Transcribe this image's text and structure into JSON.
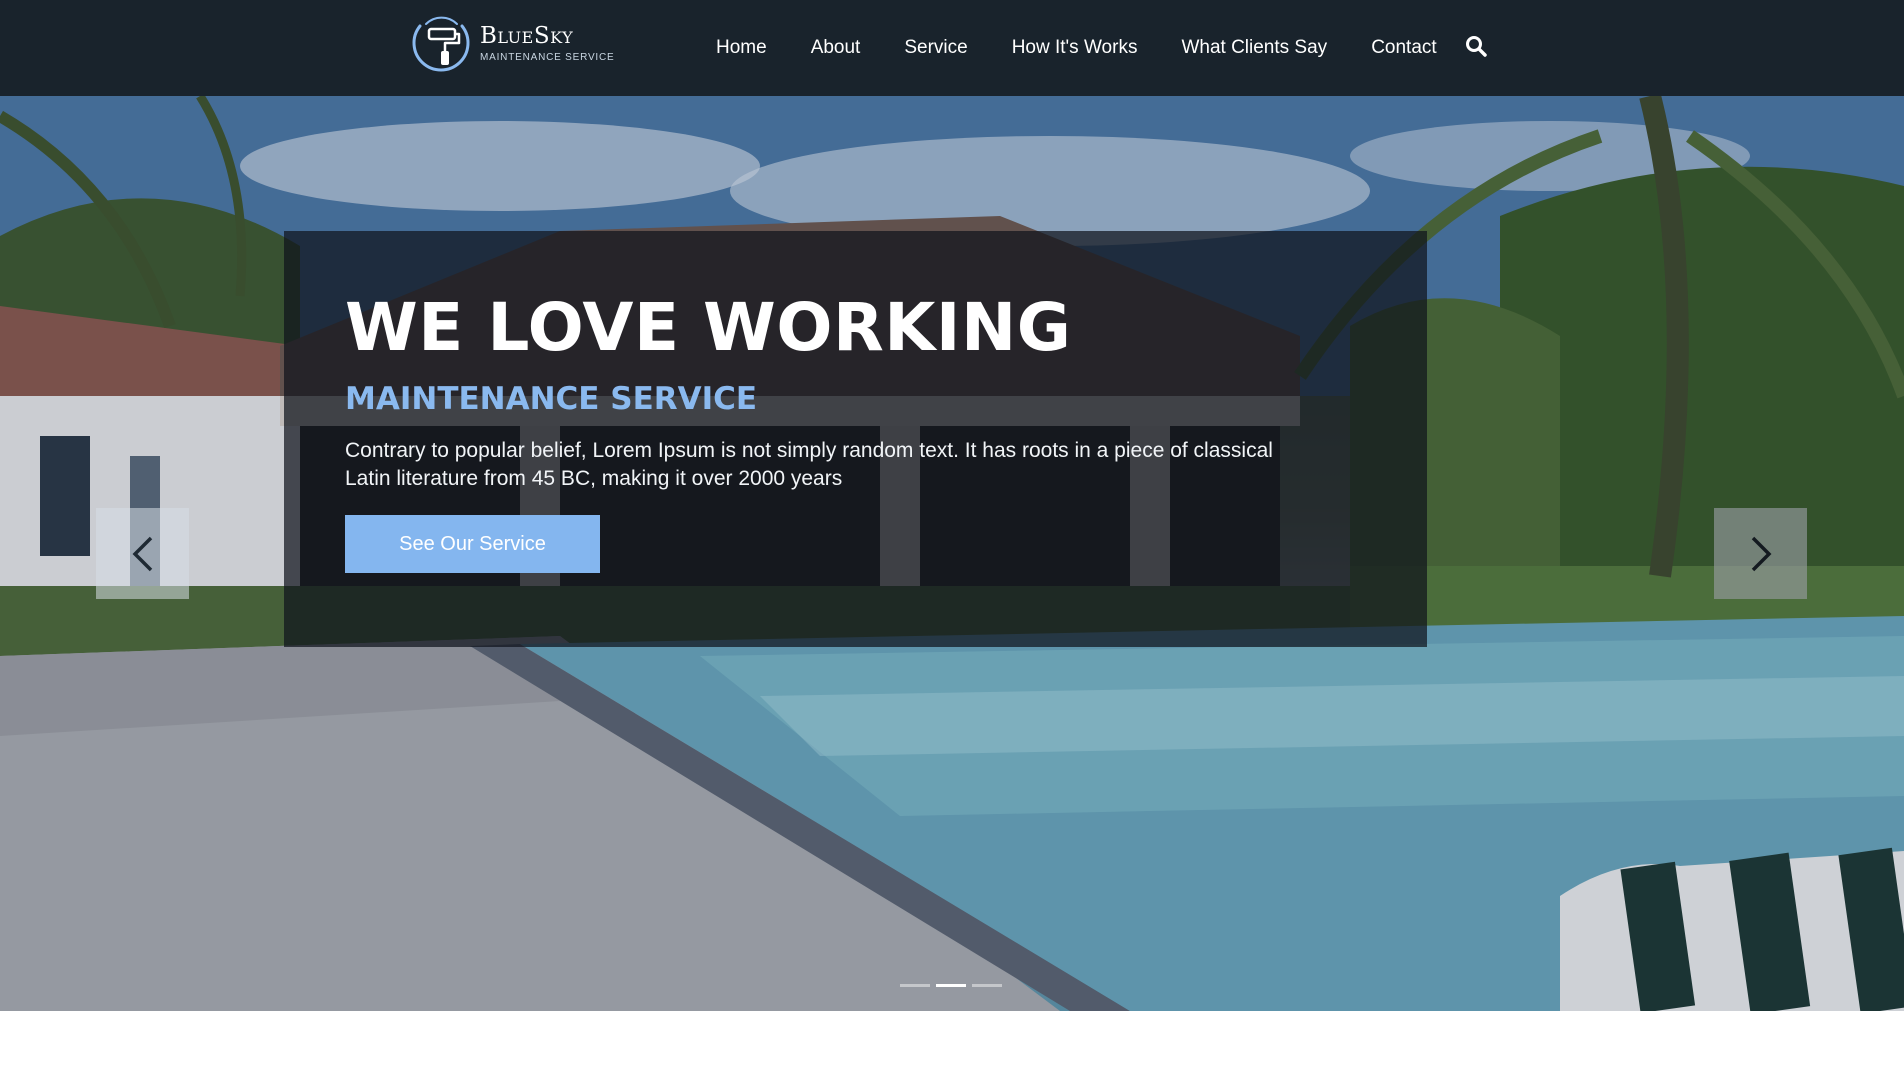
{
  "brand": {
    "name": "BlueSky",
    "tagline": "MAINTENANCE SERVICE",
    "accent_color": "#84b6ef",
    "nav_background": "#19232c"
  },
  "nav": {
    "items": [
      {
        "label": "Home"
      },
      {
        "label": "About"
      },
      {
        "label": "Service"
      },
      {
        "label": "How It's Works"
      },
      {
        "label": "What Clients Say"
      },
      {
        "label": "Contact"
      }
    ],
    "search_icon": "search-icon"
  },
  "hero": {
    "title": "WE LOVE WORKING",
    "subtitle": "MAINTENANCE SERVICE",
    "text": "Contrary to popular belief, Lorem Ipsum is not simply random text. It has roots in a piece of classical Latin literature from 45 BC, making it over 2000 years",
    "button_label": "See Our Service",
    "prev_icon": "chevron-left-icon",
    "next_icon": "chevron-right-icon",
    "slide_count": 3,
    "active_slide": 2
  }
}
